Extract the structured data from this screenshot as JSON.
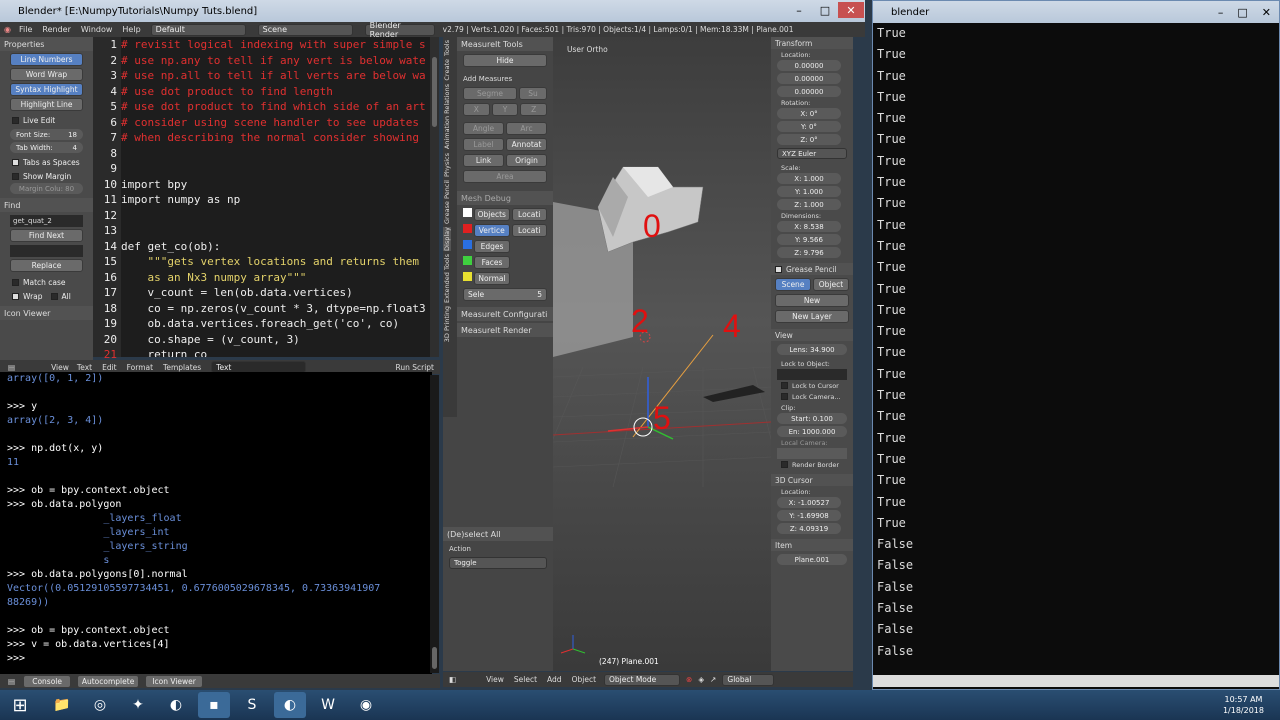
{
  "blender_window": {
    "title": "Blender* [E:\\NumpyTutorials\\Numpy Tuts.blend]",
    "menu": [
      "File",
      "Render",
      "Window",
      "Help"
    ],
    "layout": "Default",
    "scene": "Scene",
    "engine": "Blender Render",
    "stats": "v2.79 | Verts:1,020 | Faces:501 | Tris:970 | Objects:1/4 | Lamps:0/1 | Mem:18.33M | Plane.001"
  },
  "text_props": {
    "header": "Properties",
    "line_numbers": "Line Numbers",
    "word_wrap": "Word Wrap",
    "syntax_highlight": "Syntax Highlight",
    "highlight_line": "Highlight Line",
    "live_edit": "Live Edit",
    "font_size_label": "Font Size:",
    "font_size": "18",
    "tab_width_label": "Tab Width:",
    "tab_width": "4",
    "tabs_as_spaces": "Tabs as Spaces",
    "show_margin": "Show Margin",
    "margin_column": "Margin Colu: 80",
    "find_header": "Find",
    "find_value": "get_quat_2",
    "find_next": "Find Next",
    "replace": "Replace",
    "match_case": "Match case",
    "wrap": "Wrap",
    "all": "All",
    "icon_viewer": "Icon Viewer"
  },
  "code": {
    "line_numbers": [
      "1",
      "2",
      "3",
      "4",
      "5",
      "6",
      "7",
      "8",
      "9",
      "10",
      "11",
      "12",
      "13",
      "14",
      "15",
      "16",
      "17",
      "18",
      "19",
      "20",
      "21"
    ],
    "lines": [
      "# revisit logical indexing with super simple s",
      "# use np.any to tell if any vert is below wate",
      "# use np.all to tell if all verts are below wa",
      "# use dot product to find length",
      "# use dot product to find which side of an art",
      "# consider using scene handler to see updates",
      "# when describing the normal consider showing",
      "",
      "",
      "import bpy",
      "import numpy as np",
      "",
      "",
      "def get_co(ob):",
      "    \"\"\"gets vertex locations and returns them",
      "    as an Nx3 numpy array\"\"\"",
      "    v_count = len(ob.data.vertices)",
      "    co = np.zeros(v_count * 3, dtype=np.float3",
      "    ob.data.vertices.foreach_get('co', co)",
      "    co.shape = (v_count, 3)",
      "    return co"
    ]
  },
  "text_header": {
    "menu": [
      "View",
      "Text",
      "Edit",
      "Format",
      "Templates"
    ],
    "text_name": "Text",
    "run_script": "Run Script"
  },
  "console": {
    "lines": [
      "array([0, 1, 2])",
      "",
      ">>> y",
      "array([2, 3, 4])",
      "",
      ">>> np.dot(x, y)",
      "11",
      "",
      ">>> ob = bpy.context.object",
      ">>> ob.data.polygon",
      "                _layers_float",
      "                _layers_int",
      "                _layers_string",
      "                s",
      ">>> ob.data.polygons[0].normal",
      "Vector((0.05129105597734451, 0.6776005029678345, 0.73363941907",
      "88269))",
      "",
      ">>> ob = bpy.context.object",
      ">>> v = ob.data.vertices[4]",
      ">>> "
    ],
    "footer": [
      "Console",
      "Autocomplete",
      "Icon Viewer"
    ]
  },
  "tool_tabs": [
    "Tools",
    "Create",
    "Relations",
    "Animation",
    "Physics",
    "Grease Pencil",
    "Display",
    "Extended Tools",
    "3D Printing"
  ],
  "tools": {
    "header": "MeasureIt Tools",
    "hide": "Hide",
    "add_measures": "Add Measures",
    "segment": "Segme",
    "su": "Su",
    "x": "X",
    "y": "Y",
    "z": "Z",
    "angle": "Angle",
    "arc": "Arc",
    "label": "Label",
    "annotate": "Annotat",
    "link": "Link",
    "origin": "Origin",
    "area": "Area",
    "mesh_debug": "Mesh Debug",
    "objects": "Objects",
    "locati1": "Locati",
    "vertices": "Vertice",
    "locati2": "Locati",
    "edges": "Edges",
    "faces": "Faces",
    "normal": "Normal",
    "sele": "Sele",
    "sele_val": "5",
    "configuration": "MeasureIt Configurati",
    "render": "MeasureIt Render",
    "deselect_header": "(De)select All",
    "action_label": "Action",
    "action_value": "Toggle"
  },
  "viewport": {
    "view_label": "User Ortho",
    "object_label": "(247) Plane.001",
    "markers": [
      "0",
      "2",
      "4",
      "5"
    ],
    "footer": [
      "View",
      "Select",
      "Add",
      "Object"
    ],
    "mode": "Object Mode",
    "orientation": "Global"
  },
  "transform": {
    "header": "Transform",
    "location": "Location:",
    "loc_values": [
      "0.00000",
      "0.00000",
      "0.00000"
    ],
    "rotation": "Rotation:",
    "rot_values": [
      "X:   0°",
      "Y:   0°",
      "Z:   0°"
    ],
    "euler": "XYZ Euler",
    "scale": "Scale:",
    "scale_values": [
      "X: 1.000",
      "Y: 1.000",
      "Z: 1.000"
    ],
    "dimensions": "Dimensions:",
    "dim_values": [
      "X:       8.538",
      "Y:       9.566",
      "Z:       9.796"
    ],
    "grease_pencil": "Grease Pencil",
    "scene_btn": "Scene",
    "object_btn": "Object",
    "new": "New",
    "new_layer": "New Layer",
    "view": "View",
    "lens": "Lens:  34.900",
    "lock_to_object": "Lock to Object:",
    "lock_to_cursor": "Lock to Cursor",
    "lock_camera": "Lock Camera...",
    "clip": "Clip:",
    "clip_start": "Start:   0.100",
    "clip_end": "En: 1000.000",
    "local_camera": "Local Camera:",
    "render_border": "Render Border",
    "cursor_header": "3D Cursor",
    "cursor_location": "Location:",
    "cursor_values": [
      "X:  -1.00527",
      "Y:  -1.69908",
      "Z:   4.09319"
    ],
    "item": "Item",
    "item_name": "Plane.001"
  },
  "terminal": {
    "title": "blender",
    "lines": [
      "True",
      "True",
      "True",
      "True",
      "True",
      "True",
      "True",
      "True",
      "True",
      "True",
      "True",
      "True",
      "True",
      "True",
      "True",
      "True",
      "True",
      "True",
      "True",
      "True",
      "True",
      "True",
      "True",
      "True",
      "False",
      "False",
      "False",
      "False",
      "False",
      "False"
    ]
  },
  "taskbar": {
    "time": "10:57 AM",
    "date": "1/18/2018"
  }
}
